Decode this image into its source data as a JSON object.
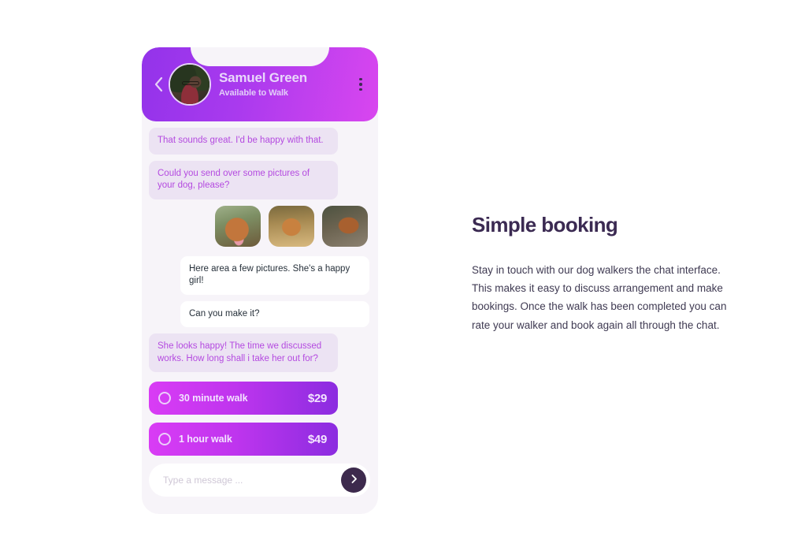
{
  "phone": {
    "header": {
      "back_icon": "chevron-left-icon",
      "avatar_icon": "avatar",
      "name": "Samuel Green",
      "status": "Available to Walk",
      "menu_icon": "kebab-menu-icon"
    },
    "messages": [
      {
        "side": "incoming",
        "text": "That sounds great. I'd be happy with that."
      },
      {
        "side": "incoming",
        "text": "Could you send over some pictures of your dog, please?"
      },
      {
        "side": "outgoing",
        "text": "Here area a few pictures. She's a happy girl!"
      },
      {
        "side": "outgoing",
        "text": "Can you make it?"
      },
      {
        "side": "incoming",
        "text": "She looks happy! The time we discussed works. How long shall i take her out for?"
      }
    ],
    "photos": [
      {
        "name": "dog-photo-1"
      },
      {
        "name": "dog-photo-2"
      },
      {
        "name": "dog-photo-3"
      }
    ],
    "options": [
      {
        "label": "30 minute walk",
        "price": "$29",
        "radio_icon": "radio-unchecked-icon"
      },
      {
        "label": "1 hour walk",
        "price": "$49",
        "radio_icon": "radio-unchecked-icon"
      }
    ],
    "composer": {
      "value": "",
      "placeholder": "Type a message ...",
      "send_icon": "chevron-right-icon"
    }
  },
  "panel": {
    "title": "Simple booking",
    "body": "Stay in touch with our dog walkers the chat interface. This makes it easy to discuss arrangement and make bookings. Once the walk has been completed you can rate your walker and book again all through the chat."
  },
  "colors": {
    "header_gradient_start": "#9333ea",
    "header_gradient_end": "#d946ef",
    "option_gradient_start": "#d93cf5",
    "option_gradient_end": "#8b2ce0",
    "chat_background": "#f7f4f9",
    "incoming_bubble": "#ece3f3",
    "incoming_text": "#b44ae0",
    "outgoing_bubble": "#ffffff",
    "outgoing_text": "#26303a",
    "send_button": "#3d2a4d",
    "heading": "#3b2a52"
  }
}
